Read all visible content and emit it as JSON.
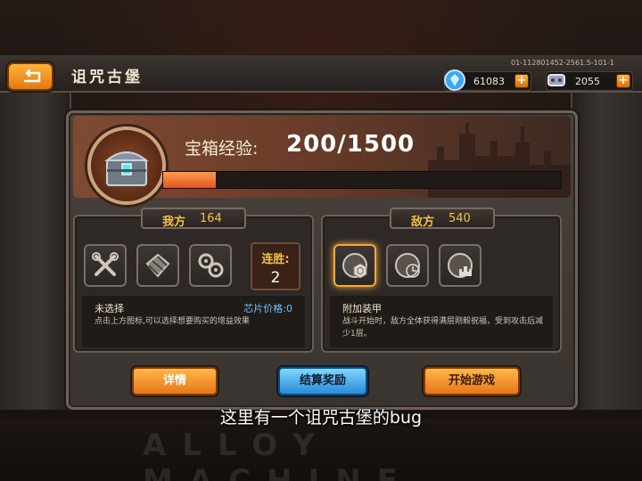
{
  "header": {
    "title": "诅咒古堡",
    "build_id": "01-112801452-2561.5-101-1"
  },
  "resources": {
    "gems": "61083",
    "coins": "2055",
    "plus": "+",
    "colors": {
      "gem": "#3fa7f2",
      "coin": "#9aa3b8"
    }
  },
  "chest": {
    "label": "宝箱经验:",
    "value": "200/1500",
    "progress_fraction": 0.133,
    "icon": "treasure-chest-icon"
  },
  "our_side": {
    "tab_name": "我方",
    "tab_count": "164",
    "slots": [
      "wrench-icon",
      "armor-plates-icon",
      "gears-icon"
    ],
    "streak_label": "连胜:",
    "streak_value": "2",
    "status": "未选择",
    "chip_price": "芯片价格:0",
    "description": "点击上方图标,可以选择想要购买的增益效果"
  },
  "enemy_side": {
    "tab_name": "敌方",
    "tab_count": "540",
    "slots": [
      "hex-armor-icon",
      "clock-icon",
      "castle-icon"
    ],
    "selected_slot": 0,
    "buff_name": "附加装甲",
    "description": "战斗开始时，敌方全体获得满层刚毅祝福，受到攻击后减少1层。"
  },
  "buttons": {
    "details": "详情",
    "settle": "结算奖励",
    "start": "开始游戏"
  },
  "subtitle": "这里有一个诅咒古堡的bug",
  "watermark": "ALLOY MACHINE",
  "theme": {
    "accent_orange": "#f0a93c",
    "gold_text": "#f3c04a",
    "blue_text": "#6ec1ff"
  }
}
